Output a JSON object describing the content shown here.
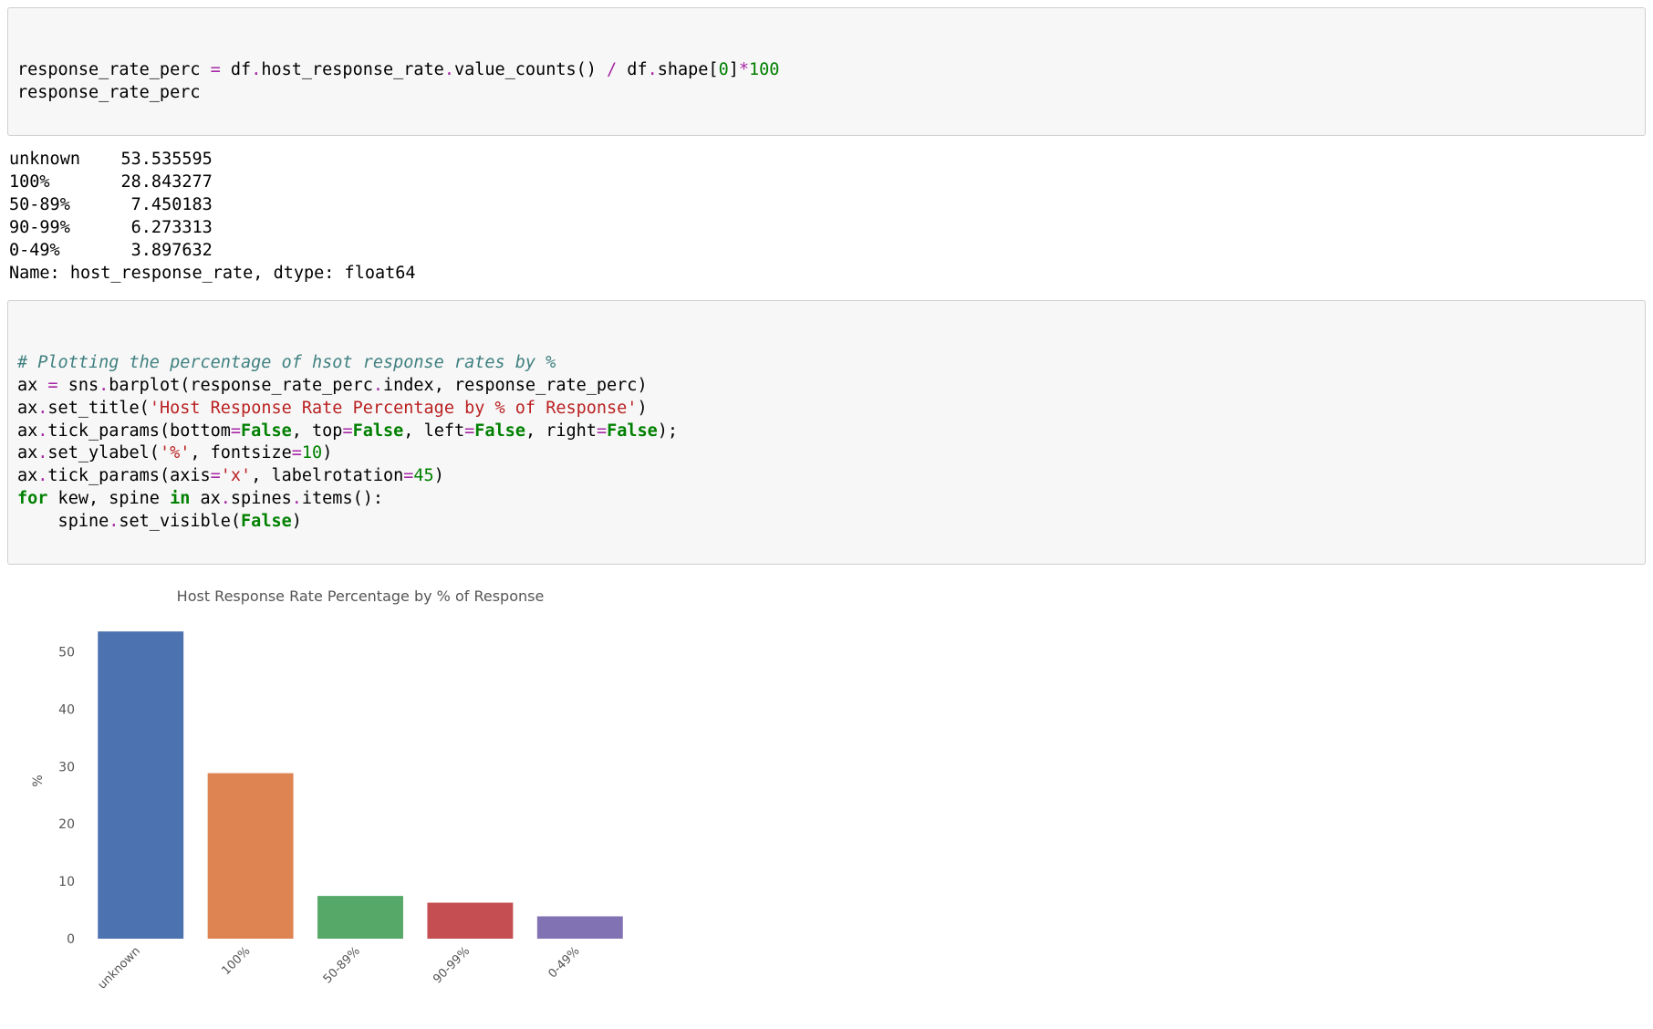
{
  "cell1": {
    "code_html": "response_rate_perc <span class=\"s-op\">=</span> df<span class=\"s-op\">.</span>host_response_rate<span class=\"s-op\">.</span>value_counts() <span class=\"s-op\">/</span> df<span class=\"s-op\">.</span>shape[<span class=\"s-num\">0</span>]<span class=\"s-op\">*</span><span class=\"s-num\">100</span>\nresponse_rate_perc"
  },
  "output1_text": "unknown    53.535595\n100%       28.843277\n50-89%      7.450183\n90-99%      6.273313\n0-49%       3.897632\nName: host_response_rate, dtype: float64",
  "cell2": {
    "code_html": "<span class=\"s-cmt\"># Plotting the percentage of hsot response rates by %</span>\nax <span class=\"s-op\">=</span> sns<span class=\"s-op\">.</span>barplot(response_rate_perc<span class=\"s-op\">.</span>index, response_rate_perc)\nax<span class=\"s-op\">.</span>set_title(<span class=\"s-str\">'Host Response Rate Percentage by % of Response'</span>)\nax<span class=\"s-op\">.</span>tick_params(bottom<span class=\"s-op\">=</span><span class=\"s-bool\">False</span>, top<span class=\"s-op\">=</span><span class=\"s-bool\">False</span>, left<span class=\"s-op\">=</span><span class=\"s-bool\">False</span>, right<span class=\"s-op\">=</span><span class=\"s-bool\">False</span>);\nax<span class=\"s-op\">.</span>set_ylabel(<span class=\"s-str\">'%'</span>, fontsize<span class=\"s-op\">=</span><span class=\"s-num\">10</span>)\nax<span class=\"s-op\">.</span>tick_params(axis<span class=\"s-op\">=</span><span class=\"s-str\">'x'</span>, labelrotation<span class=\"s-op\">=</span><span class=\"s-num\">45</span>)\n<span class=\"s-kw\">for</span> kew, spine <span class=\"s-kw\">in</span> ax<span class=\"s-op\">.</span>spines<span class=\"s-op\">.</span>items():\n    spine<span class=\"s-op\">.</span>set_visible(<span class=\"s-bool\">False</span>)"
  },
  "chart_data": {
    "type": "bar",
    "title": "Host Response Rate Percentage by % of Response",
    "ylabel": "%",
    "xlabel": "",
    "categories": [
      "unknown",
      "100%",
      "50-89%",
      "90-99%",
      "0-49%"
    ],
    "values": [
      53.535595,
      28.843277,
      7.450183,
      6.273313,
      3.897632
    ],
    "colors": [
      "#4c72b0",
      "#dd8452",
      "#55a868",
      "#c44e52",
      "#8172b3"
    ],
    "ylim": [
      0,
      55
    ],
    "yticks": [
      0,
      10,
      20,
      30,
      40,
      50
    ]
  }
}
